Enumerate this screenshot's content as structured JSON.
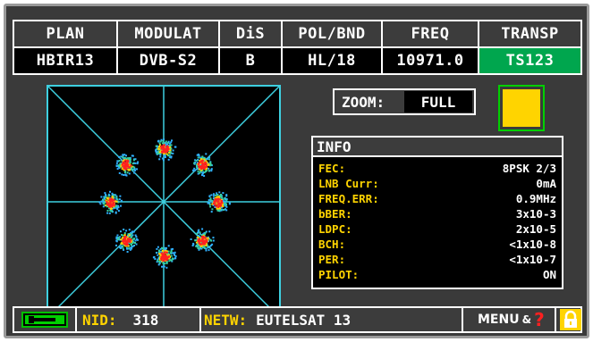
{
  "header": {
    "columns": [
      {
        "label": "PLAN",
        "value": "HBIR13"
      },
      {
        "label": "MODULAT",
        "value": "DVB-S2"
      },
      {
        "label": "DiS",
        "value": "B"
      },
      {
        "label": "POL/BND",
        "value": "HL/18"
      },
      {
        "label": "FREQ",
        "value": "10971.0"
      },
      {
        "label": "TRANSP",
        "value": "TS123"
      }
    ]
  },
  "zoom": {
    "label": "ZOOM:",
    "value": "FULL"
  },
  "colors": {
    "lock_indicator": "#ffd400",
    "transp_value_bg": "#00a64e",
    "label_yellow": "#ffd400",
    "constellation_border": "#3ed0e0"
  },
  "info": {
    "title": "INFO",
    "rows": [
      {
        "label": "FEC:",
        "value": "8PSK 2/3"
      },
      {
        "label": "LNB Curr:",
        "value": "0mA"
      },
      {
        "label": "FREQ.ERR:",
        "value": "0.9MHz"
      },
      {
        "label": "bBER:",
        "value": "3x10-3"
      },
      {
        "label": "LDPC:",
        "value": "2x10-5"
      },
      {
        "label": "BCH:",
        "value": "<1x10-8"
      },
      {
        "label": "PER:",
        "value": "<1x10-7"
      },
      {
        "label": "PILOT:",
        "value": "ON"
      }
    ]
  },
  "constellation": {
    "modulation_points": 8
  },
  "footer": {
    "battery_icon": "battery-charging-icon",
    "nid_label": "NID:",
    "nid_value": "318",
    "netw_label": "NETW:",
    "netw_value": "EUTELSAT 13",
    "menu_label": "MENU",
    "amp": "&",
    "help_icon": "?",
    "lock_icon": "lock-icon"
  }
}
